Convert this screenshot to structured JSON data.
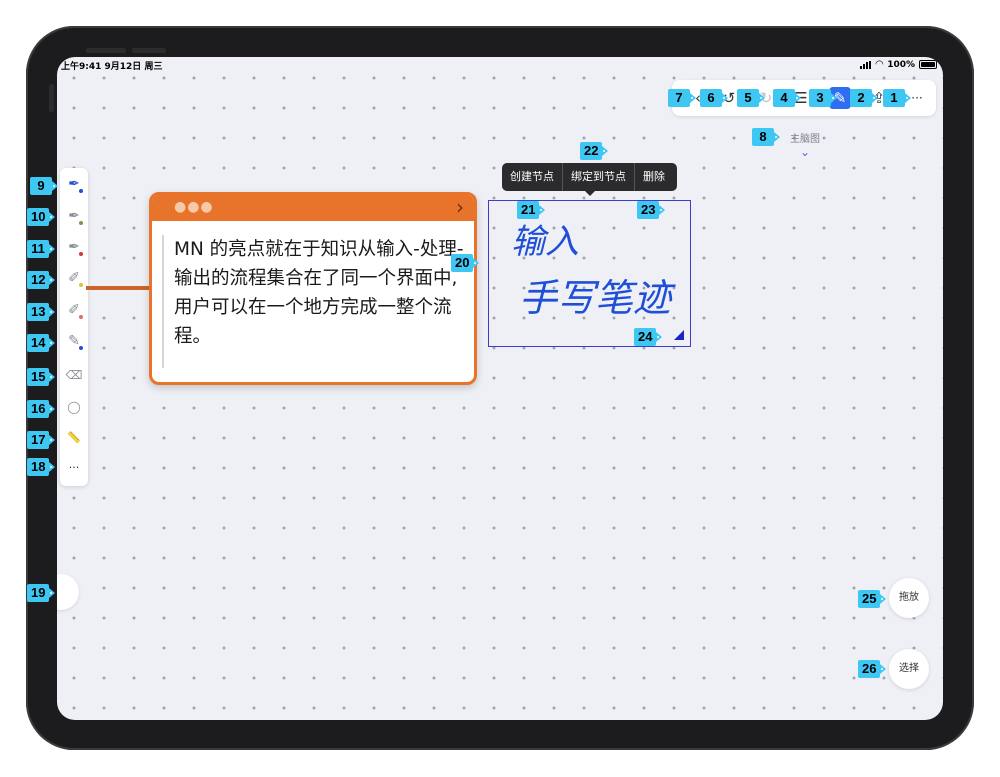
{
  "status_bar": {
    "time_date": "上午9:41  9月12日 周三",
    "battery": "100%"
  },
  "toolbar": {
    "icons": [
      "back-icon",
      "undo-icon",
      "redo-icon",
      "outline-list-icon",
      "handwriting-icon",
      "share-icon",
      "more-icon"
    ],
    "back_glyph": "‹",
    "undo_glyph": "↺",
    "redo_glyph": "↻",
    "list_glyph": "☰",
    "handwriting_glyph": "✎",
    "share_glyph": "⇪",
    "more_glyph": "···"
  },
  "mindmap_toggle": {
    "label": "主脑图",
    "chevron": "⌄"
  },
  "sidebar": {
    "tools": [
      {
        "icon": "fountain-pen-icon",
        "glyph": "✒",
        "dot": "#2251d0"
      },
      {
        "icon": "pen-icon",
        "glyph": "✒",
        "dot": "#7a9a4a"
      },
      {
        "icon": "pen-icon",
        "glyph": "✒",
        "dot": "#d23b3b"
      },
      {
        "icon": "highlighter-icon",
        "glyph": "✐",
        "dot": "#e2c23a"
      },
      {
        "icon": "highlighter-icon",
        "glyph": "✐",
        "dot": "#e06b6b"
      },
      {
        "icon": "pencil-icon",
        "glyph": "✎",
        "dot": "#2251d0"
      },
      {
        "icon": "eraser-icon",
        "glyph": "⌫",
        "dot": ""
      },
      {
        "icon": "lasso-icon",
        "glyph": "◯",
        "dot": ""
      },
      {
        "icon": "ruler-icon",
        "glyph": "📏",
        "dot": ""
      },
      {
        "icon": "more-icon",
        "glyph": "···",
        "dot": ""
      }
    ]
  },
  "node": {
    "dots": "●●●",
    "arrow": "›",
    "text": "MN 的亮点就在于知识从输入-处理-输出的流程集合在了同一个界面中,用户可以在一个地方完成一整个流程。"
  },
  "context_menu": {
    "create_node": "创建节点",
    "bind_to_node": "绑定到节点",
    "delete": "删除"
  },
  "handwriting": {
    "line1": "输入",
    "line2": "手写笔迹",
    "ink_color": "#1f4fd8"
  },
  "fab": {
    "drag": "拖放",
    "select": "选择"
  },
  "labels": {
    "t1": "1",
    "t2": "2",
    "t3": "3",
    "t4": "4",
    "t5": "5",
    "t6": "6",
    "t7": "7",
    "t8": "8",
    "t9": "9",
    "t10": "10",
    "t11": "11",
    "t12": "12",
    "t13": "13",
    "t14": "14",
    "t15": "15",
    "t16": "16",
    "t17": "17",
    "t18": "18",
    "t19": "19",
    "t20": "20",
    "t21": "21",
    "t22": "22",
    "t23": "23",
    "t24": "24",
    "t25": "25",
    "t26": "26"
  }
}
